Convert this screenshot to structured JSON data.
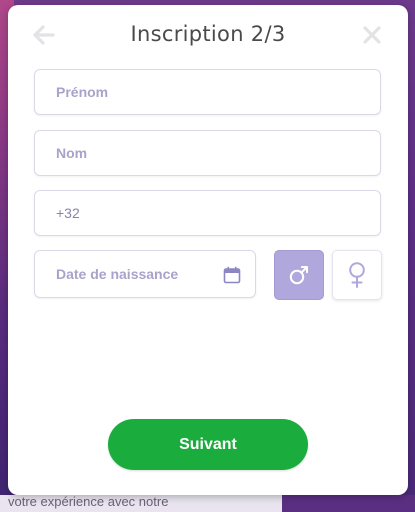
{
  "background": {
    "snippet_text": "votre expérience avec notre"
  },
  "modal": {
    "title": "Inscription 2/3",
    "back_icon": "arrow-left-icon",
    "close_icon": "close-icon"
  },
  "form": {
    "first_name": {
      "placeholder": "Prénom",
      "value": ""
    },
    "last_name": {
      "placeholder": "Nom",
      "value": ""
    },
    "phone": {
      "placeholder": "",
      "value": "+32"
    },
    "birth_date": {
      "placeholder": "Date de naissance",
      "value": "",
      "icon": "calendar-icon"
    },
    "gender": {
      "options": [
        {
          "id": "male",
          "icon": "male-symbol-icon",
          "selected": true
        },
        {
          "id": "female",
          "icon": "female-symbol-icon",
          "selected": false
        }
      ]
    }
  },
  "actions": {
    "next_label": "Suivant"
  },
  "colors": {
    "accent": "#b0a8dc",
    "primary_button": "#1aad3e",
    "placeholder": "#a9a2cb",
    "icon_muted": "#e3e3e6"
  }
}
